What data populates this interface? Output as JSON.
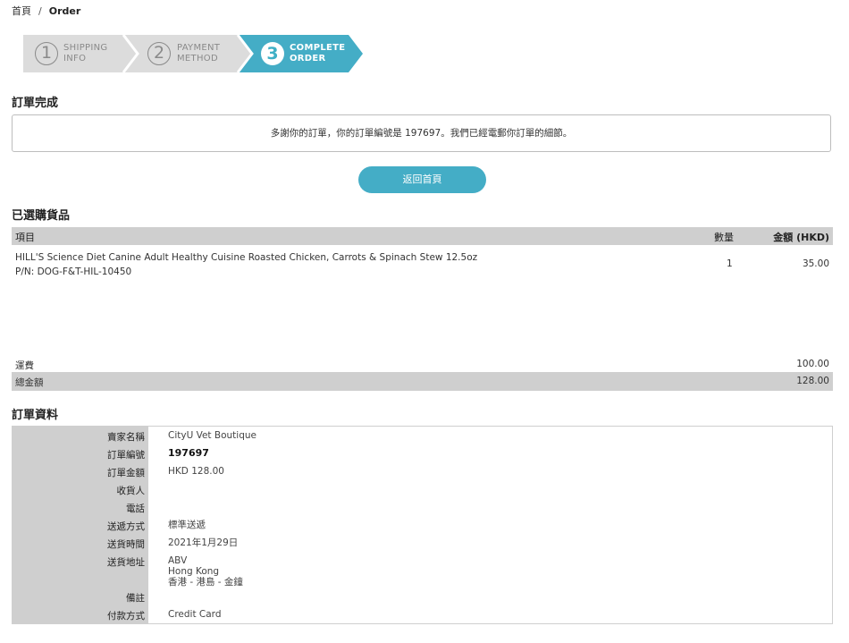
{
  "breadcrumb": {
    "home": "首頁",
    "separator": "/",
    "current": "Order"
  },
  "steps": [
    {
      "number": "1",
      "line1": "SHIPPING",
      "line2": "INFO",
      "state": "done"
    },
    {
      "number": "2",
      "line1": "PAYMENT",
      "line2": "METHOD",
      "state": "done"
    },
    {
      "number": "3",
      "line1": "COMPLETE",
      "line2": "ORDER",
      "state": "active"
    }
  ],
  "complete": {
    "title": "訂單完成",
    "message": "多謝你的訂單，你的訂單編號是 197697。我們已經電郵你訂單的細節。",
    "home_button": "返回首頁"
  },
  "cart": {
    "title": "已選購貨品",
    "headers": {
      "item": "項目",
      "qty": "數量",
      "amount": "金額 (HKD)"
    },
    "items": [
      {
        "name": "HILL'S Science Diet Canine Adult Healthy Cuisine Roasted Chicken, Carrots & Spinach Stew 12.5oz",
        "pn": "P/N: DOG-F&T-HIL-10450",
        "qty": "1",
        "amount": "35.00"
      }
    ],
    "shipping_label": "運費",
    "shipping_value": "100.00",
    "total_label": "總金額",
    "total_value": "128.00"
  },
  "info": {
    "title": "訂單資料",
    "rows": [
      {
        "label": "賣家名稱",
        "value": "CityU Vet Boutique"
      },
      {
        "label": "訂單編號",
        "value": "197697"
      },
      {
        "label": "訂單金額",
        "value": "HKD 128.00"
      },
      {
        "label": "收貨人",
        "value": ""
      },
      {
        "label": "電話",
        "value": ""
      },
      {
        "label": "送遞方式",
        "value": "標準送遞"
      },
      {
        "label": "送貨時間",
        "value": "2021年1月29日"
      },
      {
        "label": "送貨地址",
        "value": "ABV",
        "value2": "Hong Kong",
        "value3": "香港 - 港島 - 金鐘"
      },
      {
        "label": "備註",
        "value": ""
      },
      {
        "label": "付款方式",
        "value": "Credit Card"
      }
    ]
  },
  "colors": {
    "accent": "#44adc6",
    "step_inactive": "#dcdcdc",
    "table_header": "#cfcfcf"
  }
}
